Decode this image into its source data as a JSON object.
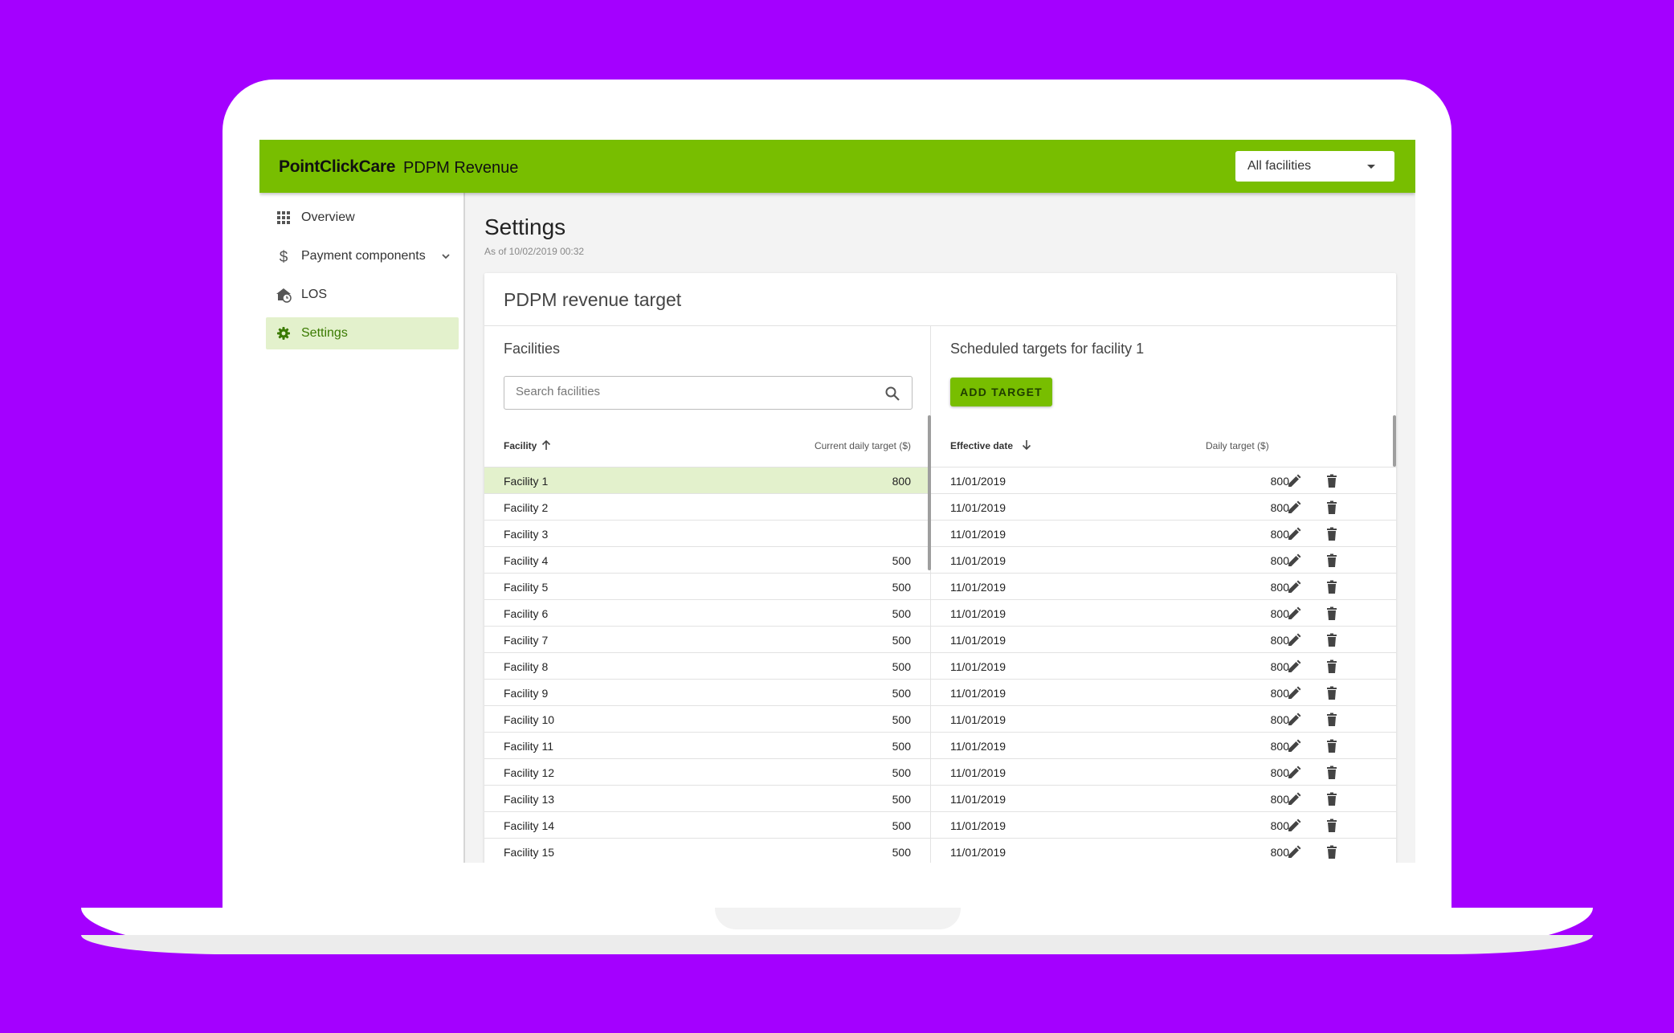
{
  "header": {
    "brand": "PointClickCare",
    "app_title": "PDPM Revenue",
    "facility_select": "All facilities"
  },
  "sidebar": {
    "items": [
      {
        "label": "Overview",
        "icon": "grid-icon"
      },
      {
        "label": "Payment components",
        "icon": "dollar-icon",
        "expandable": true
      },
      {
        "label": "LOS",
        "icon": "home-clock-icon"
      },
      {
        "label": "Settings",
        "icon": "gear-icon",
        "active": true
      }
    ]
  },
  "page": {
    "title": "Settings",
    "subtitle": "As of 10/02/2019 00:32"
  },
  "card": {
    "title": "PDPM revenue target"
  },
  "facilities_panel": {
    "title": "Facilities",
    "search_placeholder": "Search facilities",
    "col_facility": "Facility",
    "col_target": "Current daily target ($)",
    "rows": [
      {
        "name": "Facility 1",
        "target": "800",
        "selected": true
      },
      {
        "name": "Facility 2",
        "target": ""
      },
      {
        "name": "Facility 3",
        "target": ""
      },
      {
        "name": "Facility 4",
        "target": "500"
      },
      {
        "name": "Facility 5",
        "target": "500"
      },
      {
        "name": "Facility 6",
        "target": "500"
      },
      {
        "name": "Facility 7",
        "target": "500"
      },
      {
        "name": "Facility 8",
        "target": "500"
      },
      {
        "name": "Facility 9",
        "target": "500"
      },
      {
        "name": "Facility 10",
        "target": "500"
      },
      {
        "name": "Facility 11",
        "target": "500"
      },
      {
        "name": "Facility 12",
        "target": "500"
      },
      {
        "name": "Facility 13",
        "target": "500"
      },
      {
        "name": "Facility 14",
        "target": "500"
      },
      {
        "name": "Facility 15",
        "target": "500"
      }
    ]
  },
  "targets_panel": {
    "title": "Scheduled targets for facility 1",
    "add_button": "ADD TARGET",
    "col_date": "Effective date",
    "col_target": "Daily target ($)",
    "rows": [
      {
        "date": "11/01/2019",
        "target": "800"
      },
      {
        "date": "11/01/2019",
        "target": "800"
      },
      {
        "date": "11/01/2019",
        "target": "800"
      },
      {
        "date": "11/01/2019",
        "target": "800"
      },
      {
        "date": "11/01/2019",
        "target": "800"
      },
      {
        "date": "11/01/2019",
        "target": "800"
      },
      {
        "date": "11/01/2019",
        "target": "800"
      },
      {
        "date": "11/01/2019",
        "target": "800"
      },
      {
        "date": "11/01/2019",
        "target": "800"
      },
      {
        "date": "11/01/2019",
        "target": "800"
      },
      {
        "date": "11/01/2019",
        "target": "800"
      },
      {
        "date": "11/01/2019",
        "target": "800"
      },
      {
        "date": "11/01/2019",
        "target": "800"
      },
      {
        "date": "11/01/2019",
        "target": "800"
      },
      {
        "date": "11/01/2019",
        "target": "800"
      }
    ]
  },
  "colors": {
    "background": "#a400ff",
    "brand_green": "#78be00",
    "selected_row": "#e3f1cc"
  }
}
